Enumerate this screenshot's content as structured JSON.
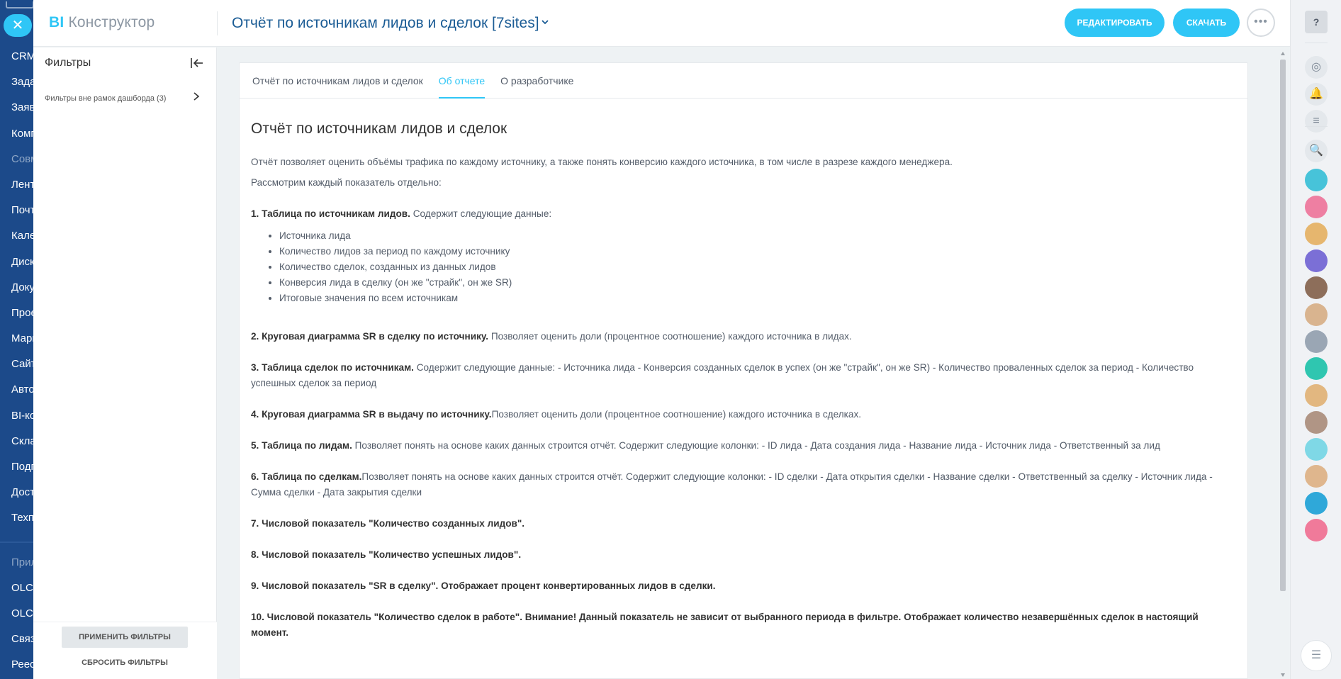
{
  "background_menu": {
    "items": [
      {
        "label": "CRM",
        "dim": false
      },
      {
        "label": "Задачи",
        "dim": false
      },
      {
        "label": "Заявки",
        "dim": false
      },
      {
        "label": "Компания",
        "dim": false
      },
      {
        "label": "Совместно",
        "dim": true
      },
      {
        "label": "Лента",
        "dim": false
      },
      {
        "label": "Почта",
        "dim": false
      },
      {
        "label": "Календарь",
        "dim": false
      },
      {
        "label": "Диск",
        "dim": false
      },
      {
        "label": "Документы",
        "dim": false
      },
      {
        "label": "Проекты",
        "dim": false
      },
      {
        "label": "Маркетинг",
        "dim": false
      },
      {
        "label": "Сайты",
        "dim": false
      },
      {
        "label": "Автоматизация",
        "dim": false
      },
      {
        "label": "BI-конструктор",
        "dim": false
      },
      {
        "label": "Склад",
        "dim": false
      },
      {
        "label": "Подписки",
        "dim": false
      },
      {
        "label": "Доступ",
        "dim": false
      },
      {
        "label": "Техподдержка",
        "dim": false
      }
    ],
    "lower_items": [
      {
        "label": "Приложения",
        "dim": true
      },
      {
        "label": "OLCRM",
        "dim": false
      },
      {
        "label": "OLCRM",
        "dim": false
      },
      {
        "label": "Связь",
        "dim": false
      },
      {
        "label": "Реестр",
        "dim": false
      }
    ]
  },
  "header": {
    "logo_bi": "BI",
    "logo_rest": "Конструктор",
    "title": "Отчёт по источникам лидов и сделок [7sites]",
    "edit_label": "РЕДАКТИРОВАТЬ",
    "download_label": "СКАЧАТЬ",
    "more_label": "•••"
  },
  "filters": {
    "title": "Фильтры",
    "item_label": "Фильтры вне рамок дашборда (3)",
    "apply_label": "ПРИМЕНИТЬ ФИЛЬТРЫ",
    "reset_label": "СБРОСИТЬ ФИЛЬТРЫ"
  },
  "tabs": [
    {
      "label": "Отчёт по источникам лидов и сделок",
      "active": false
    },
    {
      "label": "Об отчете",
      "active": true
    },
    {
      "label": "О разработчике",
      "active": false
    }
  ],
  "article": {
    "heading": "Отчёт по источникам лидов и сделок",
    "intro1": "Отчёт позволяет оценить объёмы трафика по каждому источнику, а также понять конверсию каждого источника, в том числе в разрезе каждого менеджера.",
    "intro2": "Рассмотрим каждый показатель отдельно:",
    "s1_bold": "1. Таблица по источникам лидов.",
    "s1_text": " Содержит следующие данные:",
    "s1_list": [
      "Источника лида",
      "Количество лидов за период по каждому источнику",
      "Количество сделок, созданных из данных лидов",
      "Конверсия лида в сделку (он же \"страйк\", он же SR)",
      "Итоговые значения по всем источникам"
    ],
    "s2_bold": "2. Круговая диаграмма SR в сделку по источнику.",
    "s2_text": " Позволяет оценить доли (процентное соотношение) каждого источника в лидах.",
    "s3_bold": "3. Таблица сделок по источникам.",
    "s3_text": " Содержит следующие данные: - Источника лида - Конверсия созданных сделок в успех (он же \"страйк\", он же SR) - Количество проваленных сделок за период - Количество успешных сделок за период",
    "s4_bold": "4. Круговая диаграмма SR в выдачу по источнику.",
    "s4_text": "Позволяет оценить доли (процентное соотношение) каждого источника в сделках.",
    "s5_bold": "5. Таблица по лидам.",
    "s5_text": " Позволяет понять на основе каких данных строится отчёт. Содержит следующие колонки: - ID лида - Дата создания лида - Название лида - Источник лида - Ответственный за лид",
    "s6_bold": "6. Таблица по сделкам.",
    "s6_text": "Позволяет понять на основе каких данных строится отчёт. Содержит следующие колонки: - ID сделки - Дата открытия сделки - Название сделки - Ответственный за сделку - Источник лида - Сумма сделки - Дата закрытия сделки",
    "s7_bold": "7. Числовой показатель \"Количество созданных лидов\".",
    "s8_bold": "8. Числовой показатель \"Количество успешных лидов\".",
    "s9_bold": "9. Числовой показатель \"SR в сделку\". Отображает процент конвертированных лидов в сделки.",
    "s10_bold": "10. Числовой показатель \"Количество сделок в работе\". Внимание! Данный показатель не зависит от выбранного периода в фильтре. Отображает количество незавершённых сделок в настоящий момент."
  },
  "right_bar": {
    "help_label": "?",
    "icons": [
      {
        "name": "open-channels-icon",
        "glyph": "◎"
      },
      {
        "name": "notifications-icon",
        "glyph": "🔔"
      },
      {
        "name": "chat-list-icon",
        "glyph": "≡"
      },
      {
        "name": "search-icon",
        "glyph": "🔍"
      }
    ],
    "avatars": [
      {
        "name": "avatar-contact-center",
        "color": "#47c3d9"
      },
      {
        "name": "avatar-telephony",
        "color": "#ee7fa2"
      },
      {
        "name": "avatar-user-1",
        "color": "#e6b66e"
      },
      {
        "name": "avatar-group-1",
        "color": "#7b6fd6"
      },
      {
        "name": "avatar-user-2",
        "color": "#8d6e5a"
      },
      {
        "name": "avatar-group-2",
        "color": "#d9b48f"
      },
      {
        "name": "avatar-user-3",
        "color": "#9aa6b4"
      },
      {
        "name": "avatar-bot",
        "color": "#2fc6b0"
      },
      {
        "name": "avatar-group-3",
        "color": "#e2b780"
      },
      {
        "name": "avatar-user-4",
        "color": "#b09585"
      },
      {
        "name": "avatar-chat",
        "color": "#7fd8e6"
      },
      {
        "name": "avatar-group-4",
        "color": "#dfb68d"
      },
      {
        "name": "avatar-video",
        "color": "#2fa8d9"
      },
      {
        "name": "avatar-partial",
        "color": "#f07a9a"
      }
    ],
    "bottom_label": "☰"
  }
}
